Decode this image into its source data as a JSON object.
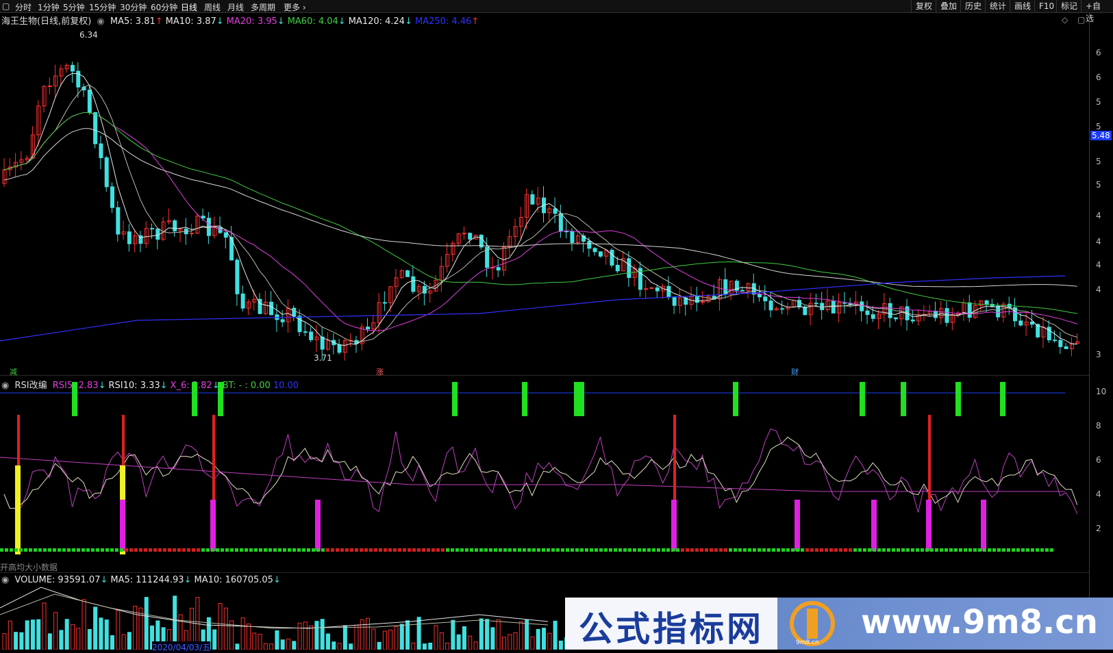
{
  "toolbar": {
    "tabs": [
      "分时",
      "1分钟",
      "5分钟",
      "15分钟",
      "30分钟",
      "60分钟",
      "日线",
      "周线",
      "月线",
      "多周期",
      "更多"
    ],
    "right_buttons": [
      "复权",
      "叠加",
      "历史",
      "统计",
      "画线",
      "F10",
      "标记",
      "+自选"
    ]
  },
  "price_panel": {
    "title": "海王生物(日线,前复权)",
    "ma": [
      {
        "label": "MA5: 3.81",
        "arrow": "↑",
        "color": "#e8e8e8"
      },
      {
        "label": "MA10: 3.87",
        "arrow": "↓",
        "color": "#e8e8e8"
      },
      {
        "label": "MA20: 3.95",
        "arrow": "↓",
        "color": "#e040e0"
      },
      {
        "label": "MA60: 4.04",
        "arrow": "↓",
        "color": "#40d040"
      },
      {
        "label": "MA120: 4.24",
        "arrow": "↓",
        "color": "#e8e8e8"
      },
      {
        "label": "MA250: 4.46",
        "arrow": "↑",
        "color": "#3030ff"
      }
    ],
    "high_label": "6.34",
    "low_label": "3.71",
    "current_tag": "5.48",
    "markers": [
      "减",
      "涨",
      "财"
    ],
    "axis_ticks": [
      "6",
      "6",
      "5",
      "5",
      "5",
      "5",
      "4",
      "4",
      "4",
      "4",
      "3"
    ]
  },
  "rsi_panel": {
    "title": "RSI改编",
    "values": [
      {
        "label": "RSI5: 2.83",
        "arrow": "↓",
        "color": "#e040e0"
      },
      {
        "label": "RSI10: 3.33",
        "arrow": "↓",
        "color": "#e8e8e8"
      },
      {
        "label": "X_6: 3.82",
        "arrow": "↓",
        "color": "#e040e0"
      },
      {
        "label": "BT: - : 0.00",
        "arrow": "",
        "color": "#40d040"
      },
      {
        "label": "10.00",
        "arrow": "",
        "color": "#3030ff"
      }
    ],
    "axis_ticks": [
      "10",
      "8",
      "6",
      "4",
      "2"
    ],
    "overlay_text": "开高均大小数据"
  },
  "volume_panel": {
    "values": [
      {
        "label": "VOLUME: 93591.07",
        "arrow": "↓",
        "color": "#e8e8e8"
      },
      {
        "label": "MA5: 111244.93",
        "arrow": "↓",
        "color": "#e8e8e8"
      },
      {
        "label": "MA10: 160705.05",
        "arrow": "↓",
        "color": "#e8e8e8"
      }
    ],
    "date_label": "2020/04/03/五"
  },
  "watermark": {
    "cn": "公式指标网",
    "url": "www.9m8.cn",
    "logo_text": "9m8.cn"
  },
  "colors": {
    "up": "#ff3030",
    "down": "#40e0e0",
    "ma5": "#e8e8e8",
    "ma20": "#e040e0",
    "ma60": "#40d040",
    "ma250": "#3030ff"
  }
}
